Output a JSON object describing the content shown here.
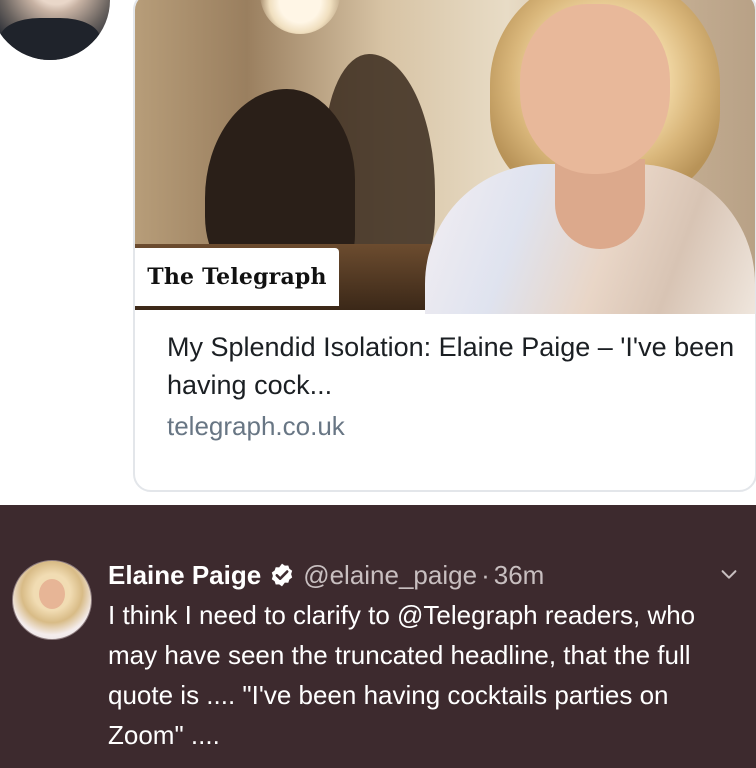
{
  "link_card": {
    "source": "The Telegraph",
    "title": "My Splendid Isolation: Elaine Paige – 'I've been having cock...",
    "domain": "telegraph.co.uk"
  },
  "tweet": {
    "author_name": "Elaine Paige",
    "handle": "@elaine_paige",
    "separator": "·",
    "time": "36m",
    "text": "I think I need to clarify to @Telegraph readers, who may have seen the truncated headline, that the full quote is .... \"I've been having cocktails parties on Zoom\" ...."
  },
  "colors": {
    "tweet_background": "#3d2a2e",
    "verified_badge": "#ffffff",
    "secondary_text": "#c8bfc0",
    "card_border": "#e3e6ea"
  },
  "icons": [
    "verified-badge-icon",
    "chevron-down-icon"
  ]
}
